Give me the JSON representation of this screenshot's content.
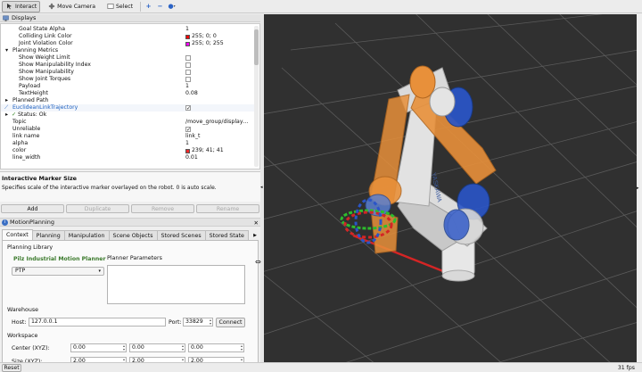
{
  "toolbar": {
    "interact": "Interact",
    "move_camera": "Move Camera",
    "select": "Select"
  },
  "displays": {
    "title": "Displays",
    "rows": [
      {
        "key": "Goal State Alpha",
        "value": "1"
      },
      {
        "key": "Colliding Link Color",
        "value": "255; 0; 0",
        "color": "#ff0000"
      },
      {
        "key": "Joint Violation Color",
        "value": "255; 0; 255",
        "color": "#ff00ff"
      },
      {
        "key": "Planning Metrics",
        "value": ""
      },
      {
        "key": "Show Weight Limit",
        "value": ""
      },
      {
        "key": "Show Manipulability Index",
        "value": ""
      },
      {
        "key": "Show Manipulability",
        "value": ""
      },
      {
        "key": "Show Joint Torques",
        "value": ""
      },
      {
        "key": "Payload",
        "value": "1"
      },
      {
        "key": "TextHeight",
        "value": "0.08"
      },
      {
        "key": "Planned Path",
        "value": ""
      },
      {
        "key": "EuclideanLinkTrajectory",
        "value": ""
      },
      {
        "key": "Status: Ok",
        "value": ""
      },
      {
        "key": "Topic",
        "value": "/move_group/display…"
      },
      {
        "key": "Unreliable",
        "value": ""
      },
      {
        "key": "link name",
        "value": "link_t"
      },
      {
        "key": "alpha",
        "value": "1"
      },
      {
        "key": "color",
        "value": "239; 41; 41",
        "color": "#ef2929"
      },
      {
        "key": "line_width",
        "value": "0.01"
      }
    ]
  },
  "description": {
    "title": "Interactive Marker Size",
    "text": "Specifies scale of the interactive marker overlayed on the robot. 0 is auto scale."
  },
  "buttons": {
    "add": "Add",
    "duplicate": "Duplicate",
    "remove": "Remove",
    "rename": "Rename"
  },
  "motion_planning": {
    "title": "MotionPlanning",
    "tabs": [
      "Context",
      "Planning",
      "Manipulation",
      "Scene Objects",
      "Stored Scenes",
      "Stored State"
    ],
    "planning_library_label": "Planning Library",
    "planner_name": "Pilz Industrial Motion Planner",
    "planner_select": "PTP",
    "planner_params_label": "Planner Parameters",
    "warehouse_label": "Warehouse",
    "host_label": "Host:",
    "host_value": "127.0.0.1",
    "port_label": "Port:",
    "port_value": "33829",
    "connect": "Connect",
    "workspace_label": "Workspace",
    "center_label": "Center (XYZ):",
    "center": [
      "0.00",
      "0.00",
      "0.00"
    ],
    "size_label": "Size (XYZ):",
    "size": [
      "2.00",
      "2.00",
      "2.00"
    ]
  },
  "status": {
    "reset": "Reset",
    "fps": "31 fps"
  },
  "colors": {
    "background_3d": "#303030",
    "grid": "#5a5a5a",
    "robot_orange": "#e8903a",
    "robot_blue": "#2a55c8",
    "trajectory_red": "#d42525"
  }
}
